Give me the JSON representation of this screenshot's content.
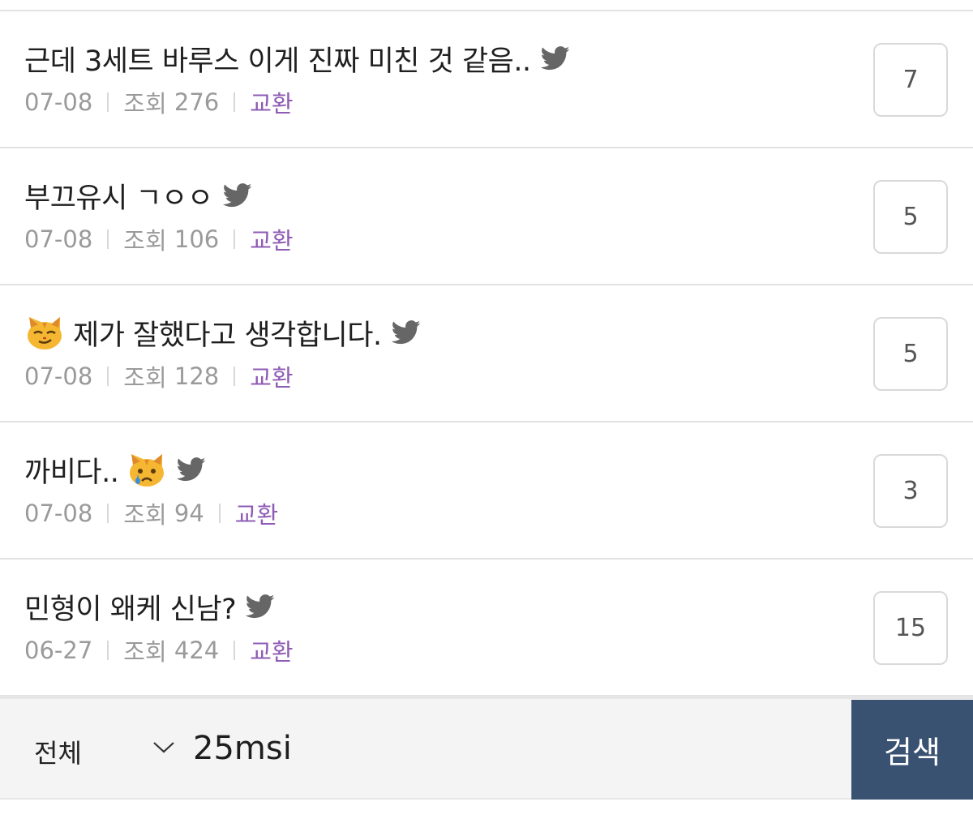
{
  "posts": [
    {
      "title": "근데 3세트 바루스 이게 진짜 미친 것 같음..",
      "lead_emoji": "",
      "trail_emoji": "",
      "date": "07-08",
      "views_label": "조회",
      "views": "276",
      "category": "교환",
      "comments": "7"
    },
    {
      "title": "부끄유시 ㄱㅇㅇ",
      "lead_emoji": "",
      "trail_emoji": "",
      "date": "07-08",
      "views_label": "조회",
      "views": "106",
      "category": "교환",
      "comments": "5"
    },
    {
      "title": "제가 잘했다고 생각합니다.",
      "lead_emoji": "smirking-cat",
      "trail_emoji": "",
      "date": "07-08",
      "views_label": "조회",
      "views": "128",
      "category": "교환",
      "comments": "5"
    },
    {
      "title": "까비다..",
      "lead_emoji": "",
      "trail_emoji": "crying-cat",
      "date": "07-08",
      "views_label": "조회",
      "views": "94",
      "category": "교환",
      "comments": "3"
    },
    {
      "title": "민형이 왜케 신남?",
      "lead_emoji": "",
      "trail_emoji": "",
      "date": "06-27",
      "views_label": "조회",
      "views": "424",
      "category": "교환",
      "comments": "15"
    }
  ],
  "search": {
    "scope": "전체",
    "query": "25msi",
    "button_label": "검색"
  },
  "icons": {
    "bird": "twitter-bird-icon",
    "dropdown": "chevron-down-icon"
  },
  "colors": {
    "category": "#8e5bb5",
    "meta": "#9a9a9a",
    "search_button": "#3a5272",
    "bird": "#666666"
  }
}
